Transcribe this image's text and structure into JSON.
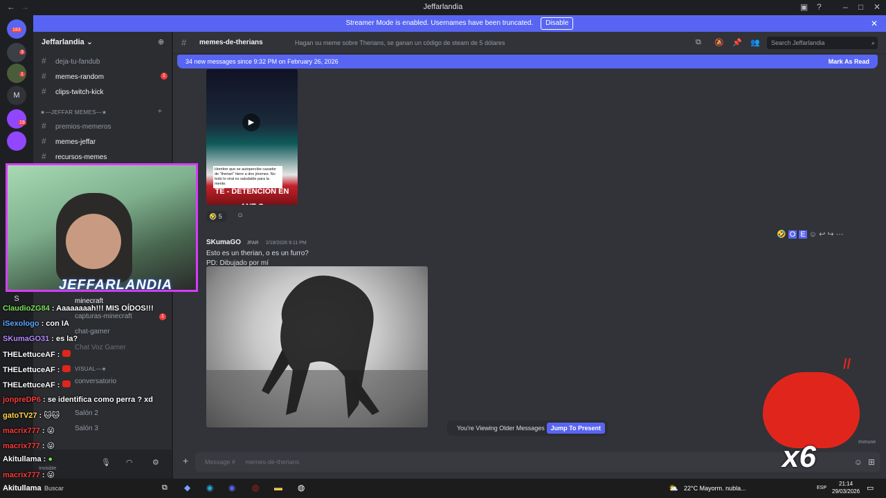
{
  "window": {
    "title": "Jeffarlandia",
    "back": "←",
    "forward": "→",
    "controls": [
      "–",
      "□",
      "✕"
    ]
  },
  "streamer_banner": {
    "text": "Streamer Mode is enabled. Usernames have been truncated.",
    "button": "Disable",
    "close": "✕"
  },
  "guilds": {
    "top_badge": "183",
    "badges": [
      "3",
      "1",
      "19"
    ],
    "letters": [
      "M",
      "S"
    ]
  },
  "server": {
    "name": "Jeffarlandia",
    "channels": [
      {
        "label": "deja-tu-fandub",
        "badge": ""
      },
      {
        "label": "memes-random",
        "badge": "1"
      },
      {
        "label": "clips-twitch-kick",
        "badge": ""
      }
    ],
    "category_memes": "★—JEFFAR MEMES—★",
    "meme_channels": [
      {
        "label": "premios-memeros",
        "badge": ""
      },
      {
        "label": "memes-jeffar",
        "badge": ""
      },
      {
        "label": "recursos-memes",
        "badge": ""
      }
    ],
    "lower_channels": [
      {
        "label": "minecraft",
        "badge": ""
      },
      {
        "label": "capturas-minecraft",
        "badge": "1"
      },
      {
        "label": "chat-gamer",
        "badge": ""
      },
      {
        "label": "Chat Voz Gamer",
        "badge": ""
      }
    ],
    "category_visual": "VISUAL—★",
    "visual_channels": [
      {
        "label": "conversatorio"
      },
      {
        "label": "Salón 2"
      },
      {
        "label": "Salón 3"
      }
    ],
    "user_status": "Invisible"
  },
  "channel_header": {
    "name": "memes-de-therians",
    "topic": "Hagan su meme sobre Therians, se ganan un código de steam de 5 dólares",
    "search_placeholder": "Search Jeffarlandia"
  },
  "new_messages": {
    "text": "34 new messages since 9:32 PM on February 26, 2026",
    "action": "Mark As Read"
  },
  "message1": {
    "image_caption": "Hombre que se autopercibe cazador de \"therian\" hiere a dos jóvenes. No todo lo viral es saludable para la mente.",
    "image_banner": "TE - DETENCIÓN EN ANT C",
    "reaction_count": "5"
  },
  "message2": {
    "author": "SKumaGO",
    "tag": "JFAR",
    "time": "2/19/2026 9:11 PM",
    "lines": [
      "Esto es un therian, o es un furro?",
      "PD: Dibujado por mí"
    ]
  },
  "older_notice": {
    "text": "You're Viewing Older Messages",
    "button": "Jump To Present"
  },
  "composer": {
    "placeholder": "Message #",
    "channel": "memes-de-therians"
  },
  "member_list_fragment": "Immune",
  "stream_overlay": {
    "logo": "JEFFARLANDIA",
    "combo": "x6"
  },
  "stream_chat": [
    {
      "user": "ClaudioZG84",
      "text": "Aaaaaaaah!!! MIS OÍDOS!!!",
      "color": "#7ee05a"
    },
    {
      "user": "iSexologo",
      "text": "con IA",
      "color": "#5aa8ff"
    },
    {
      "user": "SKumaGO31",
      "text": "es la?",
      "color": "#b48cff"
    },
    {
      "user": "THELettuceAF",
      "text": "",
      "color": "#ffffff"
    },
    {
      "user": "THELettuceAF",
      "text": "",
      "color": "#ffffff"
    },
    {
      "user": "THELettuceAF",
      "text": "",
      "color": "#ffffff"
    },
    {
      "user": "jonpreDP6",
      "text": "se identifica como perra ? xd",
      "color": "#ff3b3b"
    },
    {
      "user": "gatoTV27",
      "text": "",
      "color": "#ffd84a"
    },
    {
      "user": "macrix777",
      "text": "",
      "color": "#ff3b3b"
    },
    {
      "user": "macrix777",
      "text": "",
      "color": "#ff3b3b"
    },
    {
      "user": "Akitullama",
      "text": "",
      "color": "#ffffff"
    },
    {
      "user": "macrix777",
      "text": "",
      "color": "#ff3b3b"
    },
    {
      "user": "Akitullama",
      "text": "",
      "color": "#ffffff"
    }
  ],
  "taskbar": {
    "weather": "22°C  Mayorm. nubla...",
    "time": "21:14",
    "date": "29/03/2026",
    "lang": "ESP",
    "search": "Buscar"
  },
  "colors": {
    "blurple": "#5865f2",
    "bg_main": "#313338",
    "bg_sidebar": "#2b2d31",
    "mention_red": "#f23f43",
    "cam_border": "#d73cff"
  }
}
